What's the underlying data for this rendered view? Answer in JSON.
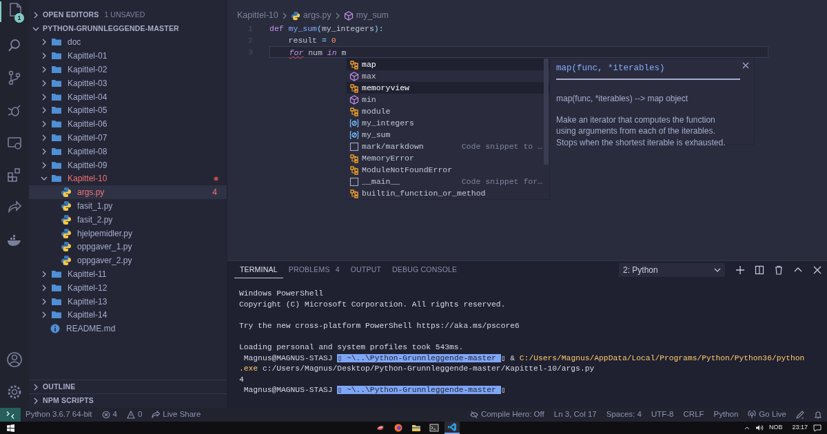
{
  "activity_bar": {
    "items": [
      {
        "kind": "files",
        "selected": true,
        "badge": "1"
      },
      {
        "kind": "search",
        "selected": false
      },
      {
        "kind": "source-control",
        "selected": false
      },
      {
        "kind": "debug",
        "selected": false
      },
      {
        "kind": "remote",
        "selected": false
      },
      {
        "kind": "extensions",
        "selected": false
      },
      {
        "kind": "live-share",
        "selected": false
      },
      {
        "kind": "docker",
        "selected": false
      }
    ],
    "bottom_items": [
      {
        "kind": "account"
      },
      {
        "kind": "settings"
      }
    ]
  },
  "sidebar": {
    "open_editors": {
      "title": "OPEN EDITORS",
      "badge": "1 UNSAVED",
      "expanded": false
    },
    "project": {
      "title": "PYTHON-GRUNNLEGGENDE-MASTER",
      "expanded": true,
      "children": [
        {
          "label": "doc",
          "kind": "folder",
          "expanded": false
        },
        {
          "label": "Kapittel-01",
          "kind": "folder",
          "expanded": false
        },
        {
          "label": "Kapittel-02",
          "kind": "folder",
          "expanded": false
        },
        {
          "label": "Kapittel-03",
          "kind": "folder",
          "expanded": false
        },
        {
          "label": "Kapittel-04",
          "kind": "folder",
          "expanded": false
        },
        {
          "label": "Kapittel-05",
          "kind": "folder",
          "expanded": false
        },
        {
          "label": "Kapittel-06",
          "kind": "folder",
          "expanded": false
        },
        {
          "label": "Kapittel-07",
          "kind": "folder",
          "expanded": false
        },
        {
          "label": "Kapittel-08",
          "kind": "folder",
          "expanded": false
        },
        {
          "label": "Kapittel-09",
          "kind": "folder",
          "expanded": false
        },
        {
          "label": "Kapittel-10",
          "kind": "folder",
          "expanded": true,
          "has_errors": true,
          "children": [
            {
              "label": "args.py",
              "kind": "python",
              "selected": true,
              "has_errors": true,
              "problems": "4"
            },
            {
              "label": "fasit_1.py",
              "kind": "python",
              "selected": false,
              "has_errors": false
            },
            {
              "label": "fasit_2.py",
              "kind": "python",
              "selected": false,
              "has_errors": false
            },
            {
              "label": "hjelpemidler.py",
              "kind": "python",
              "selected": false,
              "has_errors": false
            },
            {
              "label": "oppgaver_1.py",
              "kind": "python",
              "selected": false,
              "has_errors": false
            },
            {
              "label": "oppgaver_2.py",
              "kind": "python",
              "selected": false,
              "has_errors": false
            }
          ]
        },
        {
          "label": "Kapittel-11",
          "kind": "folder",
          "expanded": false
        },
        {
          "label": "Kapittel-12",
          "kind": "folder",
          "expanded": false
        },
        {
          "label": "Kapittel-13",
          "kind": "folder",
          "expanded": false
        },
        {
          "label": "Kapittel-14",
          "kind": "folder",
          "expanded": false
        },
        {
          "label": "README.md",
          "kind": "info",
          "selected": false,
          "has_errors": false
        }
      ]
    },
    "sections": [
      {
        "title": "OUTLINE",
        "expanded": false
      },
      {
        "title": "NPM SCRIPTS",
        "expanded": false
      }
    ]
  },
  "editor": {
    "breadcrumbs": [
      {
        "label": "Kapittel-10",
        "kind": "folder"
      },
      {
        "label": "args.py",
        "kind": "python"
      },
      {
        "label": "my_sum",
        "kind": "method"
      }
    ],
    "lines": [
      {
        "number": "1",
        "current": false,
        "indent": false,
        "tokens": [
          {
            "text": "def ",
            "kind": "keyword"
          },
          {
            "text": "my_sum",
            "kind": "function"
          },
          {
            "text": "(",
            "kind": "punct"
          },
          {
            "text": "my_integers",
            "kind": "plain"
          },
          {
            "text": "):",
            "kind": "punct"
          }
        ]
      },
      {
        "number": "2",
        "current": false,
        "indent": true,
        "tokens": [
          {
            "text": "result ",
            "kind": "plain"
          },
          {
            "text": "= ",
            "kind": "operator"
          },
          {
            "text": "0",
            "kind": "number"
          }
        ]
      },
      {
        "number": "3",
        "current": true,
        "indent": true,
        "tokens": [
          {
            "text": "for",
            "kind": "keyword-italic",
            "squiggle": true
          },
          {
            "text": " num ",
            "kind": "plain"
          },
          {
            "text": "in",
            "kind": "keyword-italic"
          },
          {
            "text": " m",
            "kind": "plain"
          }
        ]
      }
    ],
    "suggestions": [
      {
        "label": "map",
        "kind": "class",
        "highlighted": true
      },
      {
        "label": "max",
        "kind": "function",
        "highlighted": false
      },
      {
        "label": "memoryview",
        "kind": "class",
        "highlighted": true
      },
      {
        "label": "min",
        "kind": "function",
        "highlighted": false
      },
      {
        "label": "module",
        "kind": "class",
        "highlighted": false
      },
      {
        "label": "my_integers",
        "kind": "variable",
        "highlighted": false
      },
      {
        "label": "my_sum",
        "kind": "variable",
        "highlighted": false
      },
      {
        "label": "mark/markdown",
        "kind": "snippet",
        "highlighted": false,
        "detail": "Code snippet to …"
      },
      {
        "label": "MemoryError",
        "kind": "class",
        "highlighted": false
      },
      {
        "label": "ModuleNotFoundError",
        "kind": "class",
        "highlighted": false
      },
      {
        "label": "__main__",
        "kind": "snippet",
        "highlighted": false,
        "detail": "Code snippet for…"
      },
      {
        "label": "builtin_function_or_method",
        "kind": "class",
        "highlighted": false
      }
    ],
    "details": {
      "signature": "map(func, *iterables)",
      "summary": "map(func, *iterables) --> map object",
      "description": "Make an iterator that computes the function using arguments from each of the iterables. Stops when the shortest iterable is exhausted."
    }
  },
  "panel": {
    "tabs": [
      {
        "label": "TERMINAL",
        "selected": true
      },
      {
        "label": "PROBLEMS",
        "selected": false,
        "count": "4"
      },
      {
        "label": "OUTPUT",
        "selected": false
      },
      {
        "label": "DEBUG CONSOLE",
        "selected": false
      }
    ],
    "terminal_select": {
      "value": "2: Python"
    },
    "terminal_lines": [
      {
        "kind": "output",
        "segments": [
          {
            "text": "Windows PowerShell",
            "kind": "plain"
          }
        ]
      },
      {
        "kind": "output",
        "segments": [
          {
            "text": "Copyright (C) Microsoft Corporation. All rights reserved.",
            "kind": "plain"
          }
        ]
      },
      {
        "kind": "blank"
      },
      {
        "kind": "output",
        "segments": [
          {
            "text": "Try the new cross-platform PowerShell https://aka.ms/pscore6",
            "kind": "plain"
          }
        ]
      },
      {
        "kind": "blank"
      },
      {
        "kind": "output",
        "segments": [
          {
            "text": "Loading personal and system profiles took 543ms.",
            "kind": "plain"
          }
        ]
      },
      {
        "kind": "output",
        "segments": [
          {
            "text": " Magnus@MAGNUS-STASJ ",
            "kind": "plain"
          },
          {
            "text": "▯ ~\\..\\Python-Grunnleggende-master ",
            "kind": "highlight"
          },
          {
            "text": "▯",
            "kind": "plain"
          },
          {
            "text": " & ",
            "kind": "plain"
          },
          {
            "text": "C:/Users/Magnus/AppData/Local/Programs/Python/Python36/python",
            "kind": "command"
          }
        ]
      },
      {
        "kind": "output",
        "segments": [
          {
            "text": ".exe",
            "kind": "command"
          },
          {
            "text": " c:/Users/Magnus/Desktop/Python-Grunnleggende-master/Kapittel-10/args.py",
            "kind": "plain"
          }
        ]
      },
      {
        "kind": "output",
        "segments": [
          {
            "text": "4",
            "kind": "plain"
          }
        ]
      },
      {
        "kind": "output",
        "segments": [
          {
            "text": " Magnus@MAGNUS-STASJ ",
            "kind": "plain"
          },
          {
            "text": "▯ ~\\..\\Python-Grunnleggende-master ",
            "kind": "highlight"
          },
          {
            "text": "▯",
            "kind": "plain"
          }
        ]
      }
    ]
  },
  "status_bar": {
    "left": [
      {
        "kind": "remote"
      },
      {
        "kind": "text",
        "text": "Python 3.6.7 64-bit"
      },
      {
        "kind": "error",
        "text": "4"
      },
      {
        "kind": "warning",
        "text": "0"
      },
      {
        "kind": "live-share",
        "text": "Live Share"
      }
    ],
    "right": [
      {
        "kind": "compile",
        "text": "Compile Hero: Off"
      },
      {
        "kind": "text",
        "text": "Ln 3, Col 17"
      },
      {
        "kind": "text",
        "text": "Spaces: 4"
      },
      {
        "kind": "text",
        "text": "UTF-8"
      },
      {
        "kind": "text",
        "text": "CRLF"
      },
      {
        "kind": "text",
        "text": "Python"
      },
      {
        "kind": "golive",
        "text": "Go Live"
      },
      {
        "kind": "feedback"
      },
      {
        "kind": "bell"
      }
    ]
  },
  "taskbar": {
    "apps": [
      {
        "kind": "bird",
        "selected": false
      },
      {
        "kind": "firefox",
        "selected": false
      },
      {
        "kind": "explorer",
        "selected": false
      },
      {
        "kind": "terminal",
        "selected": false
      },
      {
        "kind": "vscode",
        "selected": true
      }
    ],
    "tray": {
      "language": "NOB",
      "time": "23:17"
    }
  }
}
